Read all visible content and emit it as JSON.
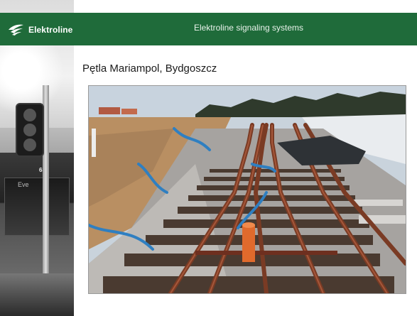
{
  "header": {
    "logo_text": "Elektroline",
    "title": "Elektroline signaling systems",
    "color": "#1f6b3a"
  },
  "slide": {
    "title": "Pętla Mariampol, Bydgoszcz"
  },
  "side_strip": {
    "bus_number": "632",
    "bus_destination": "Eve"
  }
}
